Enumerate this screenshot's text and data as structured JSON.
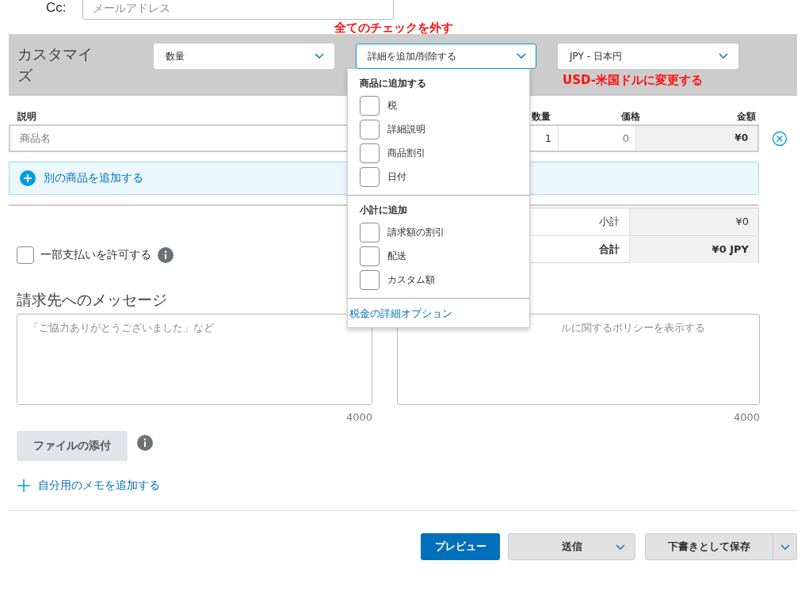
{
  "cc": {
    "label": "Cc:",
    "placeholder": "メールアドレス"
  },
  "customize": {
    "title": "カスタマイズ",
    "selects": [
      {
        "value": "数量",
        "focused": false
      },
      {
        "value": "詳細を追加/削除する",
        "focused": true
      },
      {
        "value": "JPY - 日本円",
        "focused": false
      }
    ]
  },
  "annotations": [
    {
      "text": "全てのチェックを外す"
    },
    {
      "text": "USD-米国ドルに変更する"
    }
  ],
  "table": {
    "columns": [
      "説明",
      "数量",
      "価格",
      "金額"
    ],
    "row": {
      "description_placeholder": "商品名",
      "quantity": "1",
      "price": "0",
      "amount": "¥0"
    },
    "add_item": "別の商品を追加する"
  },
  "totals": [
    {
      "label": "小計",
      "value": "¥0",
      "bold": false
    },
    {
      "label": "合計",
      "value": "¥0 JPY",
      "bold": true
    }
  ],
  "partial_payment": {
    "label": "一部支払いを許可する",
    "checked": false
  },
  "message": {
    "title": "請求先へのメッセージ",
    "placeholder": "「ご協力ありがとうございました」など",
    "count": "4000"
  },
  "policy": {
    "placeholder": "ルに関するポリシーを表示する",
    "count": "4000"
  },
  "attach_button": "ファイルの添付",
  "add_memo": "自分用のメモを追加する",
  "buttons": {
    "preview": "プレビュー",
    "send": "送信",
    "save": "下書きとして保存"
  },
  "dropdown": {
    "sections": [
      {
        "title": "商品に追加する",
        "items": [
          {
            "label": "税",
            "checked": false
          },
          {
            "label": "詳細説明",
            "checked": false
          },
          {
            "label": "商品割引",
            "checked": false
          },
          {
            "label": "日付",
            "checked": false
          }
        ]
      },
      {
        "title": "小計に追加",
        "items": [
          {
            "label": "請求額の割引",
            "checked": false
          },
          {
            "label": "配送",
            "checked": false
          },
          {
            "label": "カスタム額",
            "checked": false
          }
        ]
      }
    ],
    "link": "税金の詳細オプション"
  }
}
